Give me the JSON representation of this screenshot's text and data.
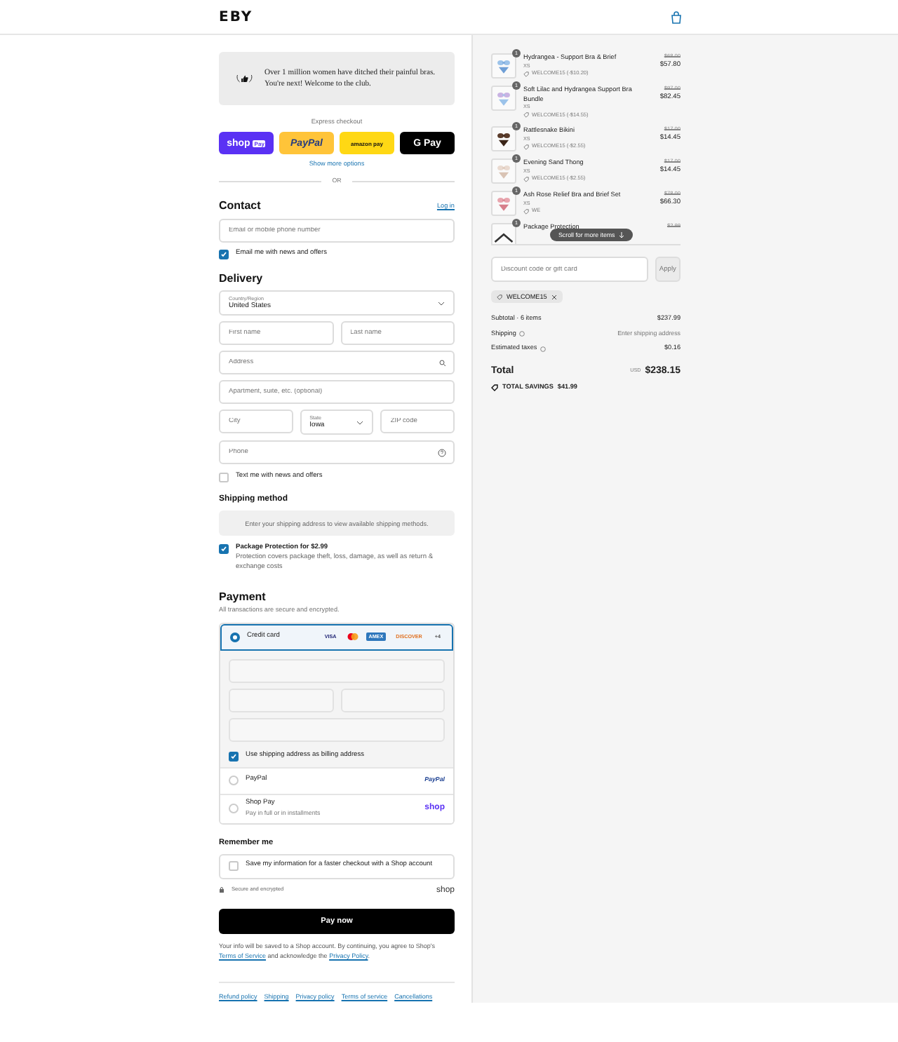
{
  "header": {
    "logo": "EBY"
  },
  "banner": {
    "text": "Over 1 million women have ditched their painful bras. You're next! Welcome to the club."
  },
  "express": {
    "label": "Express checkout",
    "buttons": [
      {
        "kind": "shoppay",
        "text": "shop",
        "badge": "Pay"
      },
      {
        "kind": "paypal",
        "text": "PayPal"
      },
      {
        "kind": "amazon",
        "text": "amazon pay"
      },
      {
        "kind": "gpay",
        "text": "G Pay"
      }
    ],
    "show_more": "Show more options",
    "divider": "OR"
  },
  "contact": {
    "heading": "Contact",
    "login": "Log in",
    "email_placeholder": "Email or mobile phone number",
    "newsletter": {
      "label": "Email me with news and offers",
      "checked": true
    }
  },
  "delivery": {
    "heading": "Delivery",
    "country": {
      "label": "Country/Region",
      "value": "United States"
    },
    "first_name": {
      "placeholder": "First name"
    },
    "last_name": {
      "placeholder": "Last name"
    },
    "address": {
      "placeholder": "Address"
    },
    "apartment": {
      "placeholder": "Apartment, suite, etc. (optional)"
    },
    "city": {
      "placeholder": "City"
    },
    "state": {
      "label": "State",
      "value": "Iowa"
    },
    "zip": {
      "placeholder": "ZIP code"
    },
    "phone": {
      "placeholder": "Phone"
    },
    "sms": {
      "label": "Text me with news and offers",
      "checked": false
    }
  },
  "shipping_method": {
    "heading": "Shipping method",
    "notice": "Enter your shipping address to view available shipping methods."
  },
  "protection": {
    "title": "Package Protection for $2.99",
    "description": "Protection covers package theft, loss, damage, as well as return & exchange costs",
    "checked": true
  },
  "payment": {
    "heading": "Payment",
    "subtitle": "All transactions are secure and encrypted.",
    "methods": [
      {
        "kind": "card",
        "label": "Credit card",
        "selected": true,
        "brands": [
          {
            "kind": "visa",
            "text": "VISA"
          },
          {
            "kind": "mastercard"
          },
          {
            "kind": "amex",
            "text": "AMEX"
          },
          {
            "kind": "discover",
            "text": "DISCOVER"
          },
          {
            "kind": "more",
            "text": "+4"
          }
        ],
        "billing": {
          "label": "Use shipping address as billing address",
          "checked": true
        }
      },
      {
        "kind": "paypal",
        "label": "PayPal",
        "selected": false,
        "logo": "PayPal"
      },
      {
        "kind": "shoppay",
        "label": "Shop Pay",
        "selected": false,
        "subtitle": "Pay in full or in installments",
        "logo": "shop"
      }
    ]
  },
  "remember": {
    "heading": "Remember me",
    "save": {
      "label": "Save my information for a faster checkout with a Shop account",
      "checked": false
    },
    "secure": "Secure and encrypted",
    "shop_logo": "shop"
  },
  "pay_button": "Pay now",
  "legal": [
    {
      "kind": "text",
      "text": "Your info will be saved to a Shop account. By continuing, you agree to Shop's "
    },
    {
      "kind": "link",
      "text": "Terms of Service"
    },
    {
      "kind": "text",
      "text": " and acknowledge the "
    },
    {
      "kind": "link",
      "text": "Privacy Policy"
    },
    {
      "kind": "text",
      "text": "."
    }
  ],
  "footer_links": [
    "Refund policy",
    "Shipping",
    "Privacy policy",
    "Terms of service",
    "Cancellations"
  ],
  "summary": {
    "items": [
      {
        "quantity": "1",
        "name": "Hydrangea - Support Bra & Brief",
        "variant": "XS",
        "discount": "WELCOME15 (-$10.20)",
        "compare_price": "$68.00",
        "price": "$57.80"
      },
      {
        "quantity": "1",
        "name": "Soft Lilac and Hydrangea Support Bra Bundle",
        "variant": "XS",
        "discount": "WELCOME15 (-$14.55)",
        "compare_price": "$97.00",
        "price": "$82.45"
      },
      {
        "quantity": "1",
        "name": "Rattlesnake Bikini",
        "variant": "XS",
        "discount": "WELCOME15 (-$2.55)",
        "compare_price": "$17.00",
        "price": "$14.45"
      },
      {
        "quantity": "1",
        "name": "Evening Sand Thong",
        "variant": "XS",
        "discount": "WELCOME15 (-$2.55)",
        "compare_price": "$17.00",
        "price": "$14.45"
      },
      {
        "quantity": "1",
        "name": "Ash Rose Relief Bra and Brief Set",
        "variant": "XS",
        "discount": "WE",
        "compare_price": "$78.00",
        "price": "$66.30"
      },
      {
        "quantity": "1",
        "name": "Package Protection",
        "compare_price": "$2.99"
      }
    ],
    "scroll_hint": "Scroll for more items",
    "discount_placeholder": "Discount code or gift card",
    "apply": "Apply",
    "code": "WELCOME15",
    "subtotal": {
      "label": "Subtotal · 6 items",
      "value": "$237.99"
    },
    "shipping": {
      "label": "Shipping",
      "value": "Enter shipping address"
    },
    "taxes": {
      "label": "Estimated taxes",
      "value": "$0.16"
    },
    "total": {
      "label": "Total",
      "currency": "USD",
      "value": "$238.15"
    },
    "savings": {
      "label": "TOTAL SAVINGS",
      "value": "$41.99"
    }
  }
}
